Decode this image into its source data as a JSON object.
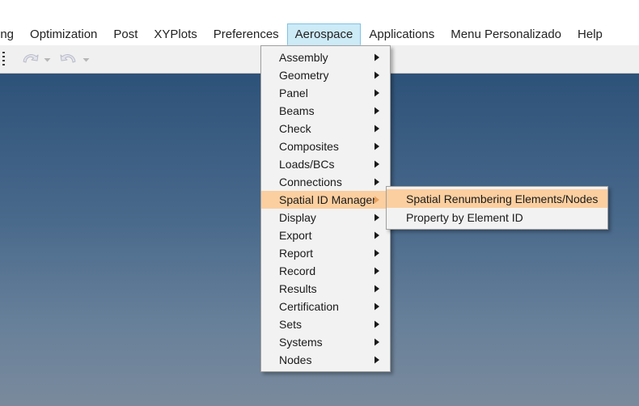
{
  "menubar": {
    "items": [
      {
        "label": "ing",
        "active": false,
        "truncated": true
      },
      {
        "label": "Optimization",
        "active": false
      },
      {
        "label": "Post",
        "active": false
      },
      {
        "label": "XYPlots",
        "active": false
      },
      {
        "label": "Preferences",
        "active": false
      },
      {
        "label": "Aerospace",
        "active": true
      },
      {
        "label": "Applications",
        "active": false
      },
      {
        "label": "Menu Personalizado",
        "active": false
      },
      {
        "label": "Help",
        "active": false
      }
    ],
    "highlight_bg": "#cdeaf7",
    "highlight_border": "#7fc2e4"
  },
  "toolbar": {
    "background": "#f0f0f0",
    "buttons": [
      {
        "name": "undo-icon",
        "tooltip": "Undo",
        "enabled": false
      },
      {
        "name": "undo-dropdown-caret",
        "tooltip": "Undo history",
        "enabled": false
      },
      {
        "name": "redo-icon",
        "tooltip": "Redo",
        "enabled": false
      },
      {
        "name": "redo-dropdown-caret",
        "tooltip": "Redo history",
        "enabled": false
      }
    ]
  },
  "canvas": {
    "gradient_top": "#2d5279",
    "gradient_bottom": "#7a8a9c"
  },
  "aerospace_menu": {
    "highlight_bg": "#fbcfa0",
    "items": [
      {
        "label": "Assembly",
        "submenu": true,
        "highlighted": false
      },
      {
        "label": "Geometry",
        "submenu": true,
        "highlighted": false
      },
      {
        "label": "Panel",
        "submenu": true,
        "highlighted": false
      },
      {
        "label": "Beams",
        "submenu": true,
        "highlighted": false
      },
      {
        "label": "Check",
        "submenu": true,
        "highlighted": false
      },
      {
        "label": "Composites",
        "submenu": true,
        "highlighted": false
      },
      {
        "label": "Loads/BCs",
        "submenu": true,
        "highlighted": false
      },
      {
        "label": "Connections",
        "submenu": true,
        "highlighted": false
      },
      {
        "label": "Spatial ID Manager",
        "submenu": true,
        "highlighted": true
      },
      {
        "label": "Display",
        "submenu": true,
        "highlighted": false
      },
      {
        "label": "Export",
        "submenu": true,
        "highlighted": false
      },
      {
        "label": "Report",
        "submenu": true,
        "highlighted": false
      },
      {
        "label": "Record",
        "submenu": true,
        "highlighted": false
      },
      {
        "label": "Results",
        "submenu": true,
        "highlighted": false
      },
      {
        "label": "Certification",
        "submenu": true,
        "highlighted": false
      },
      {
        "label": "Sets",
        "submenu": true,
        "highlighted": false
      },
      {
        "label": "Systems",
        "submenu": true,
        "highlighted": false
      },
      {
        "label": "Nodes",
        "submenu": true,
        "highlighted": false
      }
    ]
  },
  "spatial_submenu": {
    "parent": "Spatial ID Manager",
    "highlight_bg": "#fbcfa0",
    "items": [
      {
        "label": "Spatial Renumbering Elements/Nodes",
        "highlighted": true
      },
      {
        "label": "Property by Element ID",
        "highlighted": false
      }
    ]
  }
}
